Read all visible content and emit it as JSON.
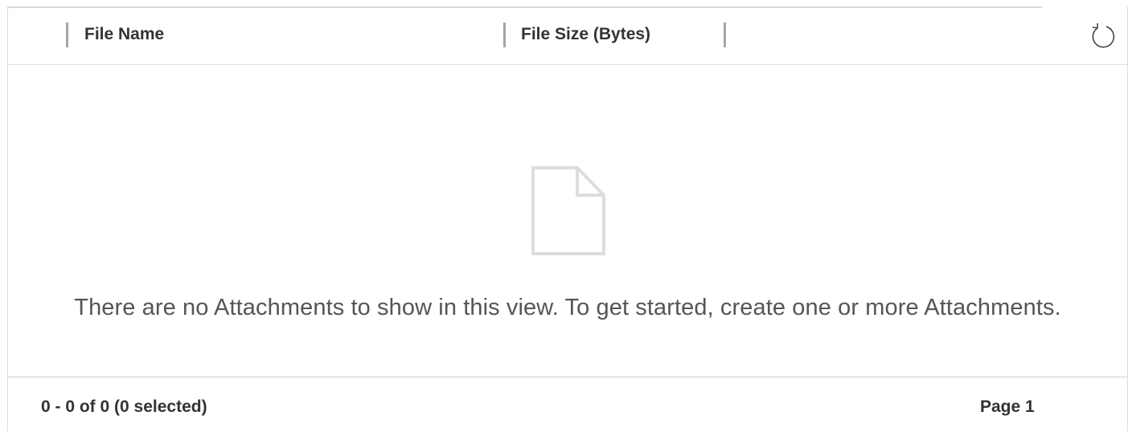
{
  "grid": {
    "columns": [
      {
        "label": "File Name"
      },
      {
        "label": "File Size (Bytes)"
      }
    ],
    "refresh_icon": "refresh-icon",
    "empty_icon": "blank-document-icon",
    "empty_message": "There are no Attachments to show in this view. To get started, create one or more Attachments."
  },
  "footer": {
    "record_count": "0 - 0 of 0 (0 selected)",
    "page_label": "Page 1"
  },
  "colors": {
    "header_text": "#333333",
    "empty_text": "#555555",
    "separator": "#a6a6a6",
    "empty_icon_stroke": "#dddddd"
  }
}
